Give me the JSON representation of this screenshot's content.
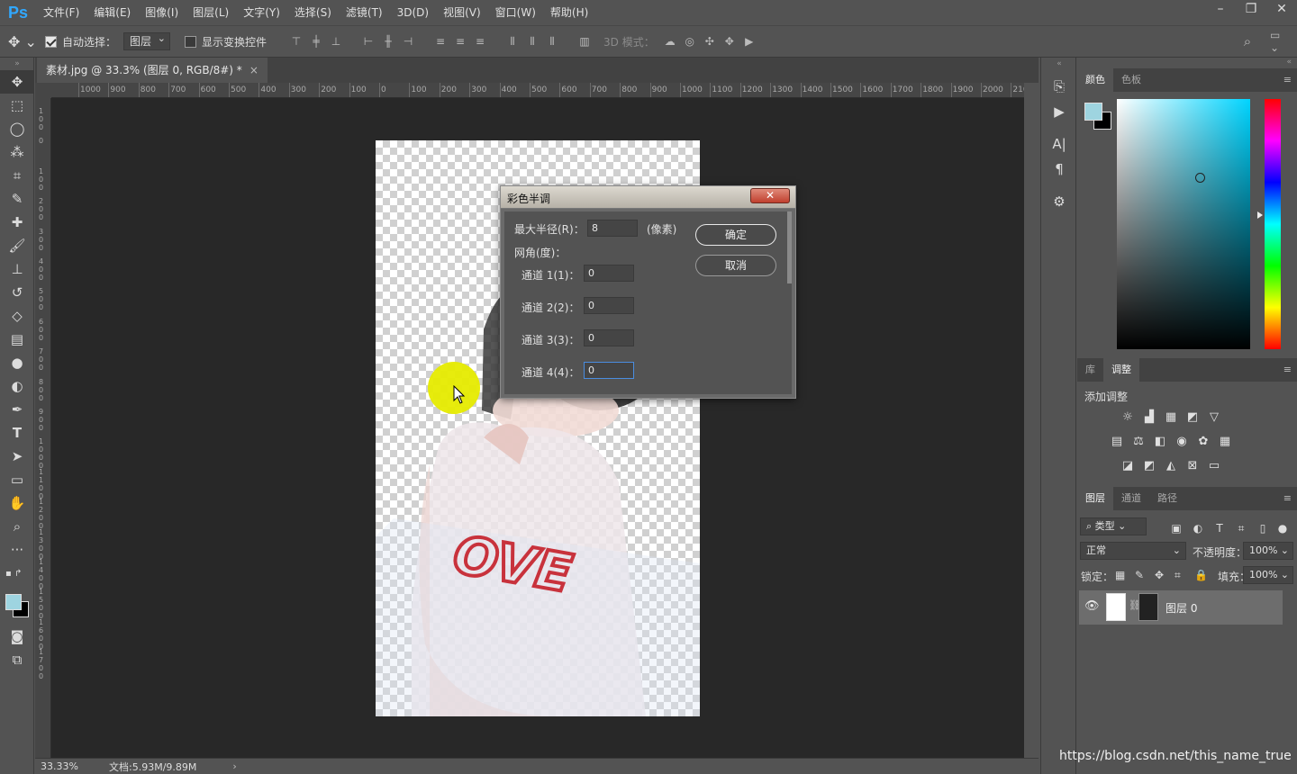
{
  "app": {
    "logo": "Ps",
    "menu": [
      "文件(F)",
      "编辑(E)",
      "图像(I)",
      "图层(L)",
      "文字(Y)",
      "选择(S)",
      "滤镜(T)",
      "3D(D)",
      "视图(V)",
      "窗口(W)",
      "帮助(H)"
    ],
    "window_controls": [
      "–",
      "❐",
      "✕"
    ]
  },
  "options_bar": {
    "auto_select_label": "自动选择：",
    "auto_select_checked": true,
    "auto_select_target": "图层",
    "show_transform_label": "显示变换控件",
    "show_transform_checked": false,
    "mode_3d_label": "3D 模式："
  },
  "document": {
    "tab_title": "素材.jpg @ 33.3% (图层 0, RGB/8#) *",
    "close": "×",
    "zoom": "33.33%",
    "doc_size": "文档:5.93M/9.89M",
    "ruler_h_ticks": [
      "1000",
      "900",
      "800",
      "700",
      "600",
      "500",
      "400",
      "300",
      "200",
      "100",
      "0",
      "100",
      "200",
      "300",
      "400",
      "500",
      "600",
      "700",
      "800",
      "900",
      "1000",
      "1100",
      "1200",
      "1300",
      "1400",
      "1500",
      "1600",
      "1700",
      "1800",
      "1900",
      "2000",
      "210"
    ],
    "ruler_v_ticks": [
      "100",
      "0",
      "100",
      "200",
      "300",
      "400",
      "500",
      "600",
      "700",
      "800",
      "900",
      "1000",
      "1100",
      "1200",
      "1300",
      "1400",
      "1500",
      "1600",
      "1700"
    ],
    "image_text": "OVE"
  },
  "dialog": {
    "title": "彩色半调",
    "close": "✕",
    "max_radius_label": "最大半径(R)：",
    "max_radius_value": "8",
    "max_radius_unit": "(像素)",
    "screen_angle_label": "网角(度)：",
    "channels": [
      {
        "label": "通道 1(1)：",
        "value": "0"
      },
      {
        "label": "通道 2(2)：",
        "value": "0"
      },
      {
        "label": "通道 3(3)：",
        "value": "0"
      },
      {
        "label": "通道 4(4)：",
        "value": "0"
      }
    ],
    "ok_label": "确定",
    "cancel_label": "取消"
  },
  "panels": {
    "color_tabs": [
      "颜色",
      "色板"
    ],
    "foreground_color": "#9ed4e0",
    "background_color": "#000000",
    "adjust_tabs": [
      "库",
      "调整"
    ],
    "add_adjustment_label": "添加调整",
    "layers_tabs": [
      "图层",
      "通道",
      "路径"
    ],
    "filter_kind": "类型",
    "blend_mode": "正常",
    "opacity_label": "不透明度：",
    "opacity_value": "100%",
    "lock_label": "锁定：",
    "fill_label": "填充：",
    "fill_value": "100%",
    "layer_name": "图层 0"
  },
  "watermark": "https://blog.csdn.net/this_name_true"
}
